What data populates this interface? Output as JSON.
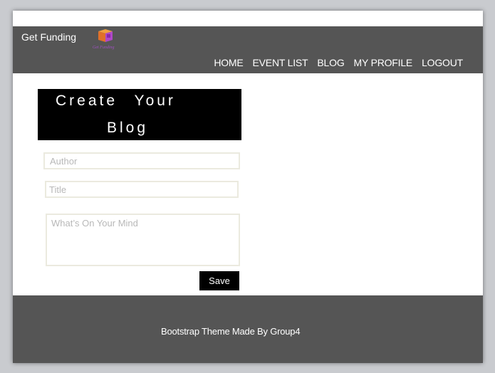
{
  "navbar": {
    "brand": "Get Funding",
    "logo_caption": "Get Funding",
    "links": [
      "HOME",
      "EVENT LIST",
      "BLOG",
      "MY PROFILE",
      "LOGOUT"
    ]
  },
  "heading": {
    "line1": "Create Your",
    "line2": "Blog"
  },
  "form": {
    "author_placeholder": "Author",
    "title_placeholder": "Title",
    "mind_placeholder": "What’s On Your Mind",
    "save_label": "Save"
  },
  "footer": {
    "text": "Bootstrap Theme Made By Group4"
  },
  "colors": {
    "navbar_bg": "#555555",
    "footer_bg": "#555555",
    "heading_bg": "#000000",
    "save_bg": "#000000"
  }
}
